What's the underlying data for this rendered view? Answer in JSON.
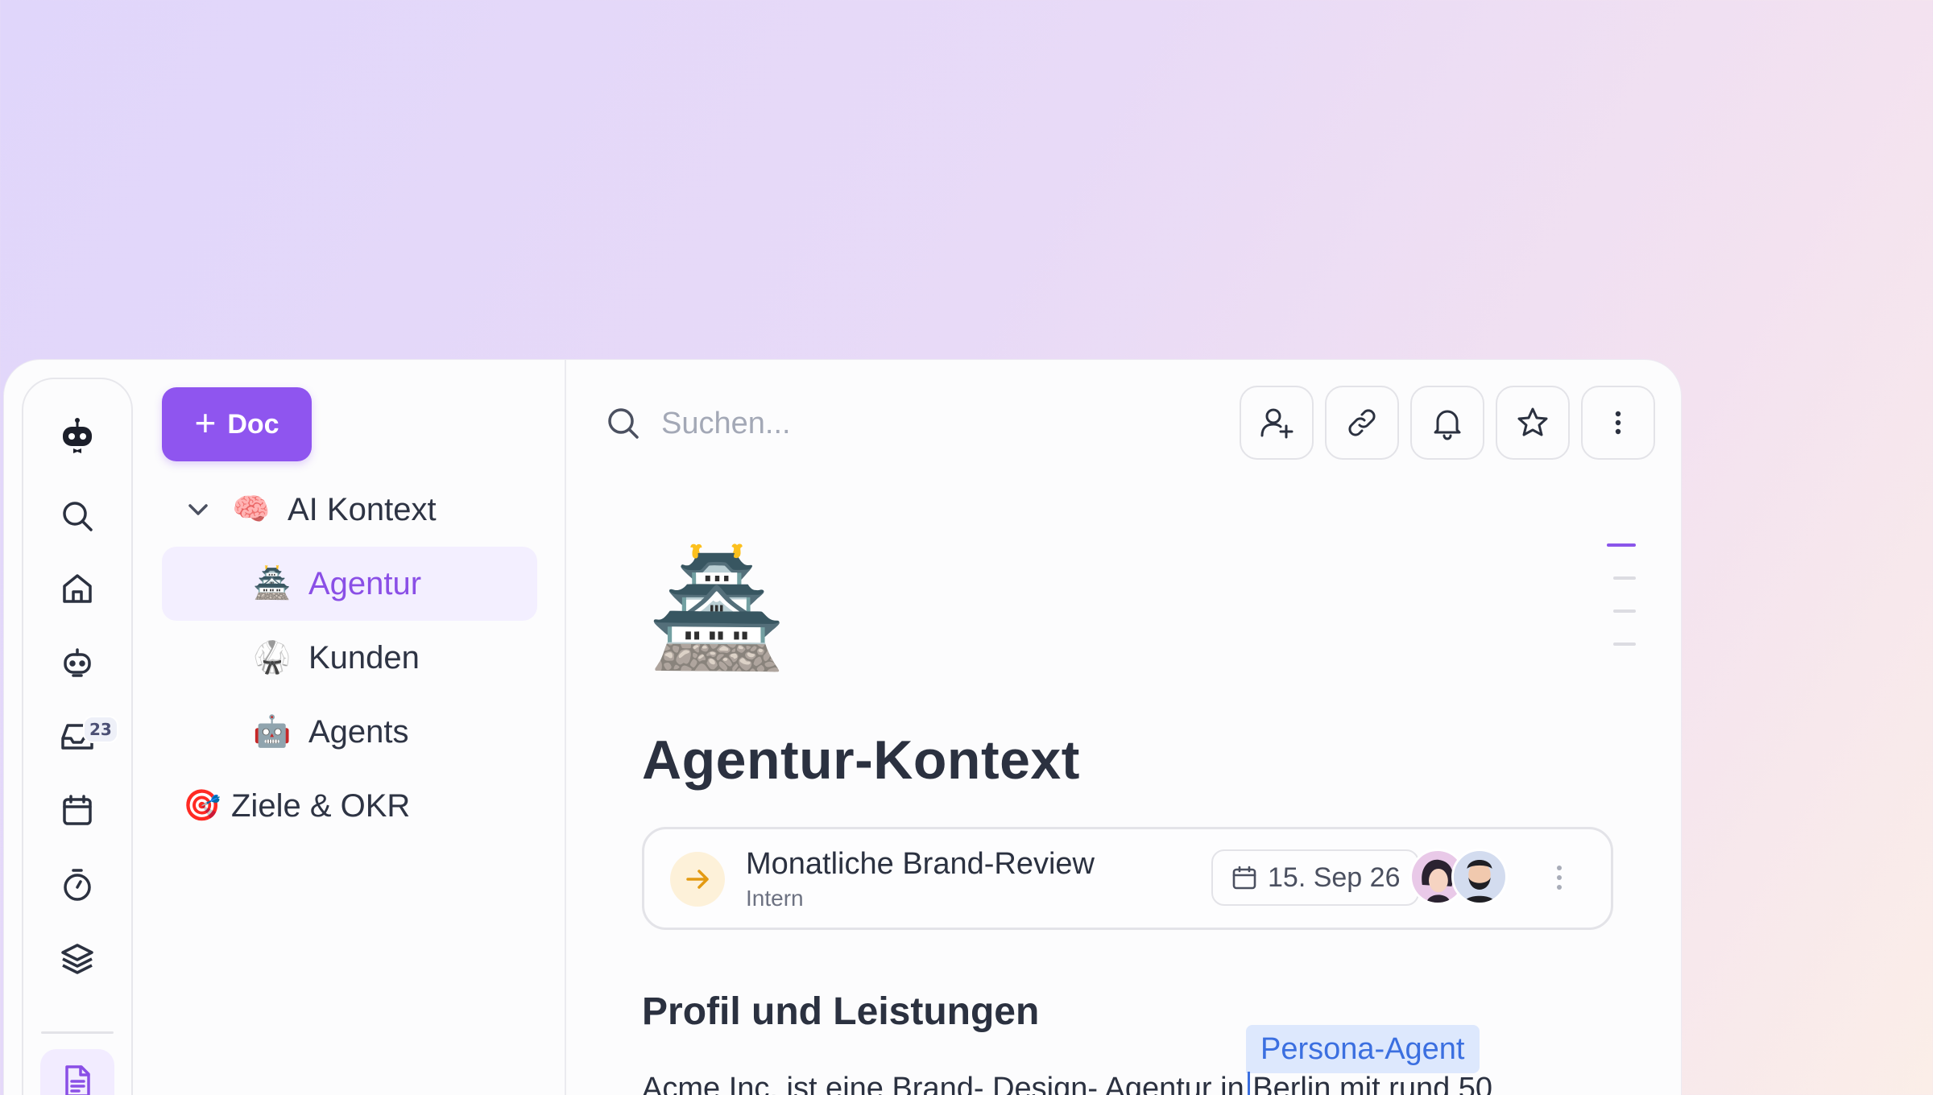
{
  "rail": {
    "inbox_badge": "23"
  },
  "sidebar": {
    "new_doc_label": "Doc",
    "items": [
      {
        "label": "AI Kontext",
        "emoji": "🧠"
      },
      {
        "label": "Agentur",
        "emoji": "🏯"
      },
      {
        "label": "Kunden",
        "emoji": "🥋"
      },
      {
        "label": "Agents",
        "emoji": "🤖"
      },
      {
        "label": "Ziele & OKR",
        "emoji": "🎯"
      }
    ]
  },
  "header": {
    "search_placeholder": "Suchen..."
  },
  "document": {
    "emoji": "🏯",
    "title": "Agentur-Kontext",
    "event": {
      "title": "Monatliche Brand-Review",
      "subtitle": "Intern",
      "date": "15. Sep 26"
    },
    "section_heading": "Profil und Leistungen",
    "body_text": "Acme Inc. ist eine Brand- Design- Agentur in Berlin mit rund 50",
    "cursor_label": "Persona-Agent"
  },
  "colors": {
    "accent": "#8f55ef",
    "cursor": "#3b6fe0"
  }
}
